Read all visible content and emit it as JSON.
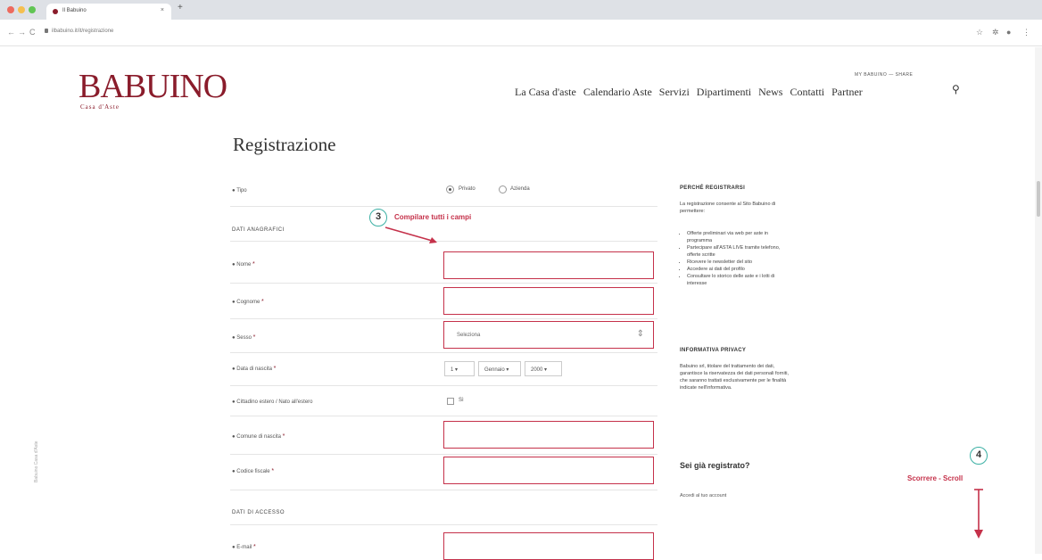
{
  "browser": {
    "tab_title": "Il Babuino",
    "tab_close": "×",
    "new_tab": "+",
    "url": "ilbabuino.it/it/registrazione",
    "back": "←",
    "forward": "→",
    "reload": "C",
    "icons": [
      "star-icon",
      "extensions-icon",
      "profile-icon",
      "menu-icon"
    ]
  },
  "site": {
    "logo": "BABUINO",
    "logo_sub": "Casa d'Aste",
    "top_links": "MY BABUINO  —  SHARE",
    "nav": [
      "La Casa d'aste",
      "Calendario Aste",
      "Servizi",
      "Dipartimenti",
      "News",
      "Contatti",
      "Partner"
    ]
  },
  "page": {
    "title": "Registrazione",
    "vertical_text": "Babuino Casa d'Aste"
  },
  "form": {
    "type_label": "Tipo",
    "type_options": [
      "Privato",
      "Azienda"
    ],
    "section_personal": "DATI ANAGRAFICI",
    "name_label": "Nome",
    "surname_label": "Cognome",
    "gender_label": "Sesso",
    "gender_value": "Seleziona",
    "birth_label": "Data di nascita",
    "birth_day": "1",
    "birth_month": "Gennaio",
    "birth_year": "2000",
    "foreign_label": "Cittadino estero / Nato all'estero",
    "foreign_value": "Sì",
    "birthplace_label": "Comune di nascita",
    "taxcode_label": "Codice fiscale",
    "section_access": "DATI DI ACCESSO",
    "email_label": "E-mail",
    "required_mark": "*"
  },
  "sidebar": {
    "heading1": "PERCHÉ REGISTRARSI",
    "intro": "La registrazione consente al Sito Babuino di permettere:",
    "bullets": [
      "Offerte preliminari via web per aste in programma",
      "Partecipare all'ASTA LIVE tramite telefono, offerte scritte",
      "Ricevere le newsletter del sito",
      "Accedere ai dati del profilo",
      "Consultare lo storico delle aste e i lotti di interesse"
    ],
    "heading2": "INFORMATIVA PRIVACY",
    "privacy_text": "Babuino srl, titolare del trattamento dei dati, garantisce la riservatezza dei dati personali forniti, che saranno trattati esclusivamente per le finalità indicate nell'informativa.",
    "already_title": "Sei già registrato?",
    "already_link": "Accedi al tuo account"
  },
  "annotations": {
    "step3_number": "3",
    "step3_text": "Compilare tutti i campi",
    "step4_number": "4",
    "step4_text": "Scorrere - Scroll"
  },
  "colors": {
    "brand": "#8a1c2b",
    "field_border": "#c5314a",
    "step_circle": "#3bb0a4"
  }
}
